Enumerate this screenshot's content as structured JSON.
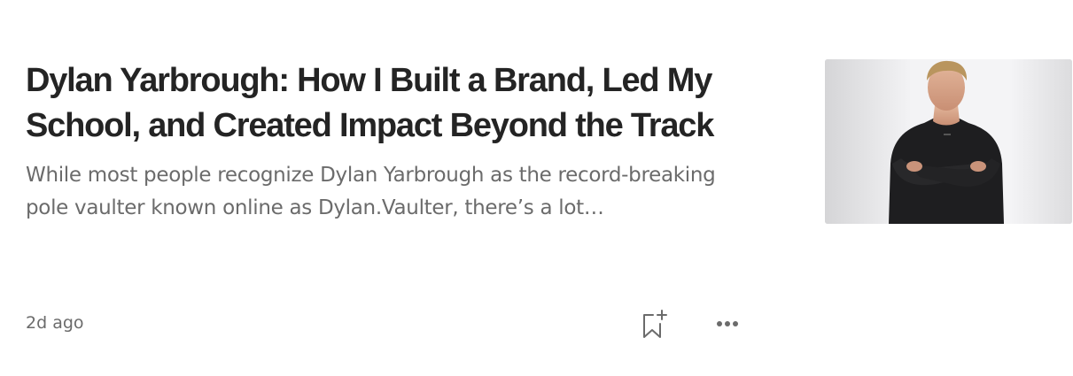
{
  "article": {
    "title": "Dylan Yarbrough: How I Built a Brand, Led My School, and Created Impact Beyond the Track",
    "subtitle": "While most people recognize Dylan Yarbrough as the record-breaking pole vaulter known online as Dylan.Vaulter, there’s a lot…",
    "published": "2d ago",
    "thumbnail_icon": "athlete-portrait-photo"
  },
  "actions": {
    "bookmark_icon": "bookmark-add-icon",
    "more_icon": "more-horizontal-icon"
  },
  "colors": {
    "title": "#242424",
    "secondary": "#6b6b6b"
  }
}
